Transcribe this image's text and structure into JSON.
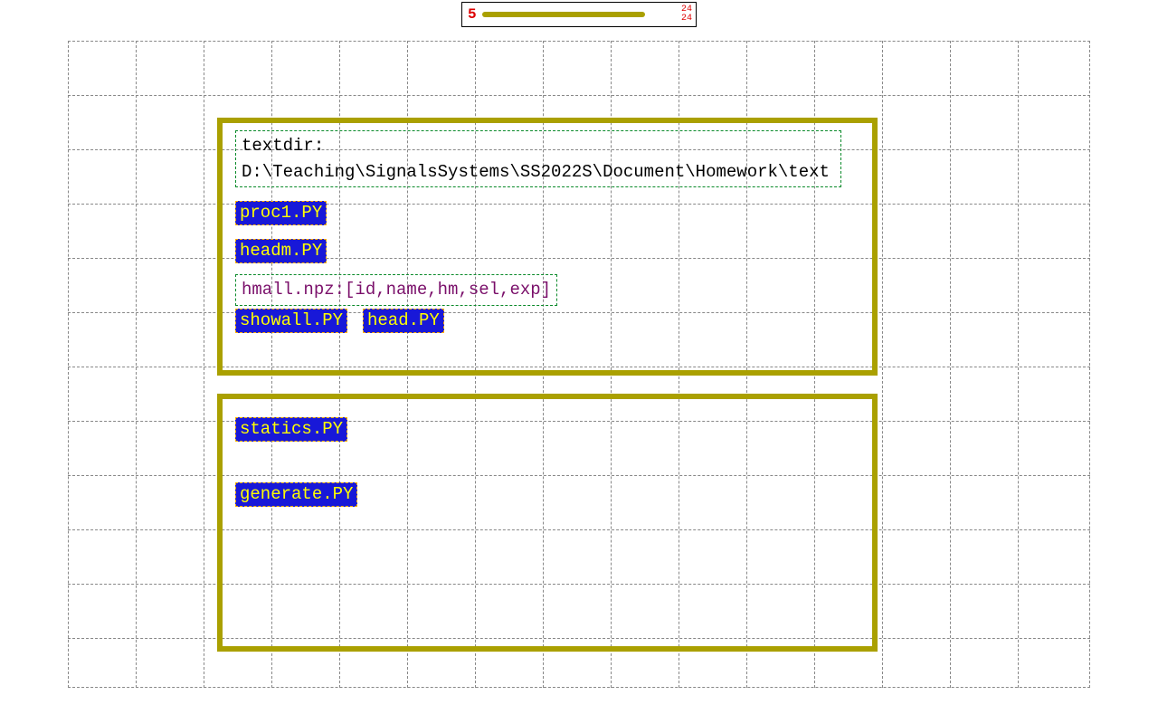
{
  "progress": {
    "left": "5",
    "top_right": "24",
    "bottom_right": "24"
  },
  "textdir_label": "textdir:",
  "textdir_path": "D:\\Teaching\\SignalsSystems\\SS2022S\\Document\\Homework\\text",
  "scripts": {
    "proc1": "proc1.PY",
    "headm": "headm.PY",
    "showall": "showall.PY",
    "head": "head.PY",
    "statics": "statics.PY",
    "generate": "generate.PY"
  },
  "npz_desc": "hmall.npz:[id,name,hm,sel,exp]"
}
